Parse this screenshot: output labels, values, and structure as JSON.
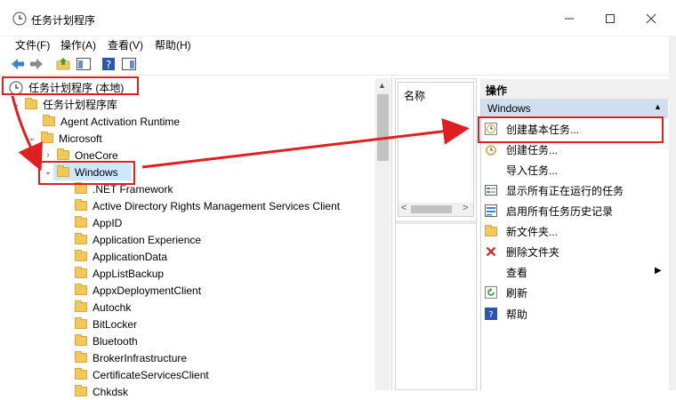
{
  "window": {
    "title": "任务计划程序",
    "controls": {
      "minimize": "—",
      "maximize": "☐",
      "close": "✕"
    }
  },
  "menu": [
    "文件(F)",
    "操作(A)",
    "查看(V)",
    "帮助(H)"
  ],
  "tree": {
    "root": "任务计划程序 (本地)",
    "library": "任务计划程序库",
    "items": [
      {
        "label": "Agent Activation Runtime"
      },
      {
        "label": "Microsoft"
      },
      {
        "label": "OneCore"
      },
      {
        "label": "Windows"
      },
      {
        "label": ".NET Framework"
      },
      {
        "label": "Active Directory Rights Management Services Client"
      },
      {
        "label": "AppID"
      },
      {
        "label": "Application Experience"
      },
      {
        "label": "ApplicationData"
      },
      {
        "label": "AppListBackup"
      },
      {
        "label": "AppxDeploymentClient"
      },
      {
        "label": "Autochk"
      },
      {
        "label": "BitLocker"
      },
      {
        "label": "Bluetooth"
      },
      {
        "label": "BrokerInfrastructure"
      },
      {
        "label": "CertificateServicesClient"
      },
      {
        "label": "Chkdsk"
      }
    ]
  },
  "middle": {
    "column_header": "名称"
  },
  "actions": {
    "header": "操作",
    "section": "Windows",
    "items": [
      {
        "label": "创建基本任务..."
      },
      {
        "label": "创建任务..."
      },
      {
        "label": "导入任务..."
      },
      {
        "label": "显示所有正在运行的任务"
      },
      {
        "label": "启用所有任务历史记录"
      },
      {
        "label": "新文件夹..."
      },
      {
        "label": "删除文件夹"
      },
      {
        "label": "查看"
      },
      {
        "label": "刷新"
      },
      {
        "label": "帮助"
      }
    ]
  },
  "colors": {
    "annotation": "#e02020",
    "selection": "#cce8ff",
    "section_bg": "#cfdff0"
  }
}
